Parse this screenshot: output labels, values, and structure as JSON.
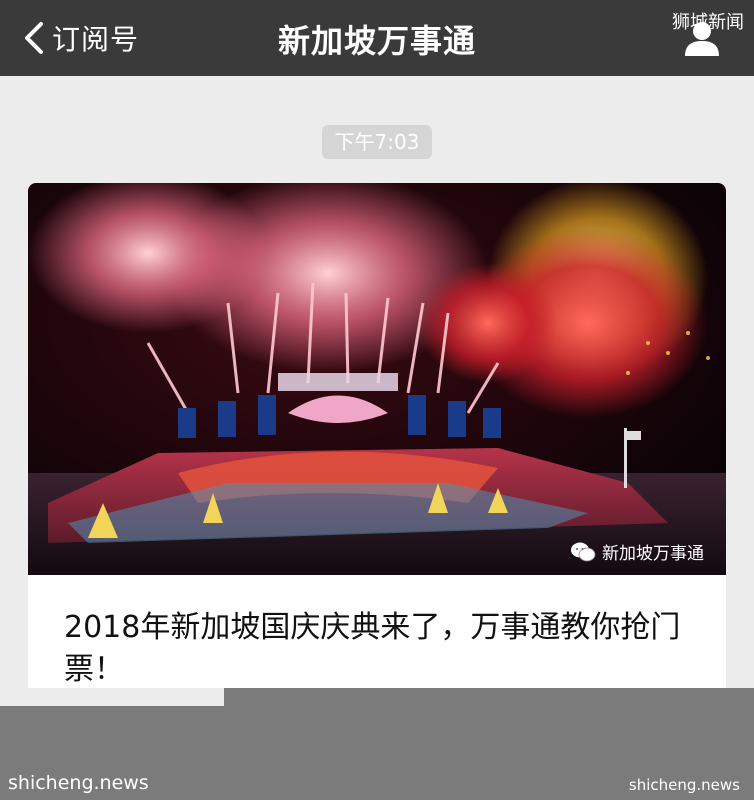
{
  "header": {
    "back_label": "订阅号",
    "title": "新加坡万事通",
    "watermark": "狮城新闻"
  },
  "chat": {
    "timestamp": "下午7:03"
  },
  "article": {
    "brand": "新加坡万事通",
    "title": "2018年新加坡国庆庆典来了，万事通教你抢门票！"
  },
  "footer": {
    "watermark_left": "shicheng.news",
    "watermark_right": "shicheng.news"
  },
  "colors": {
    "topbar": "#3a3a3a",
    "chat_bg": "#ececec",
    "timestamp_bg": "#d5d5d5",
    "page_bg": "#7b7b7b"
  }
}
